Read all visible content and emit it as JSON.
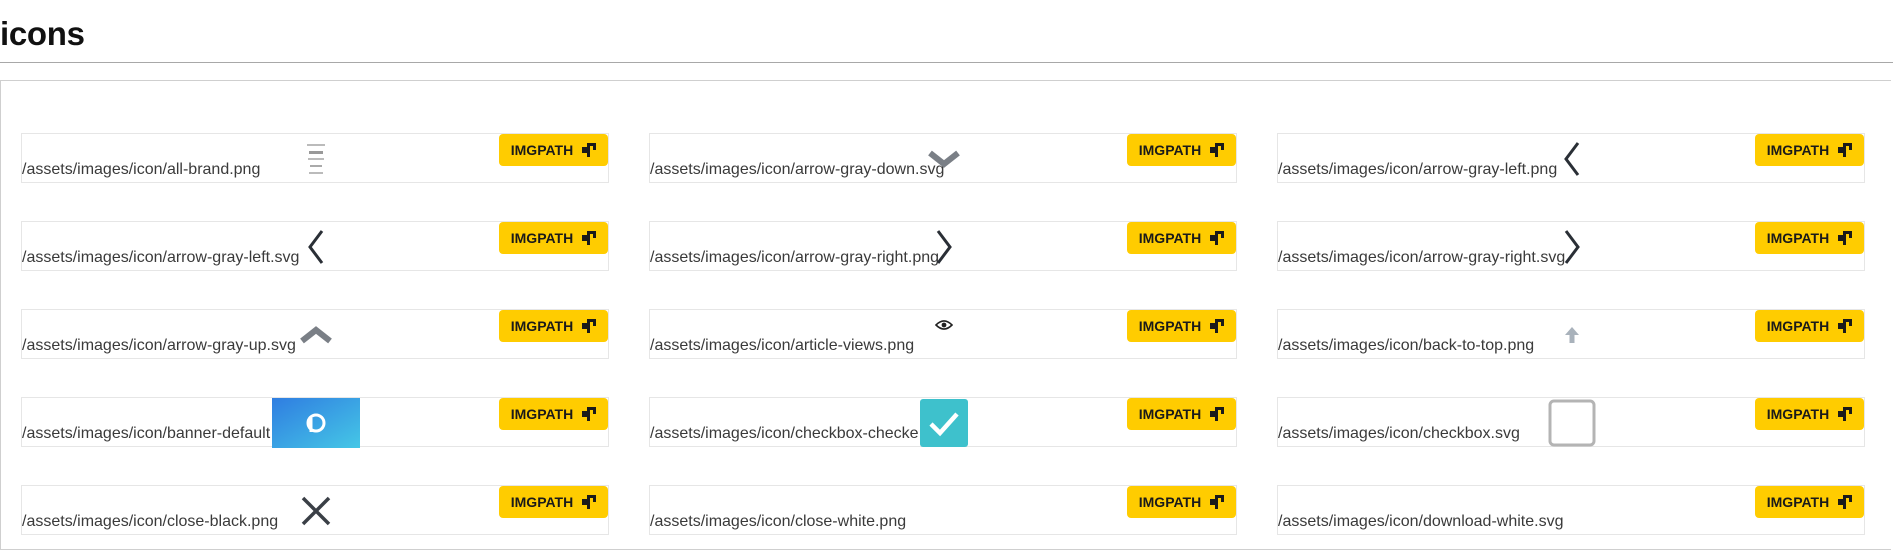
{
  "page": {
    "title": "icons"
  },
  "button_label": "IMGPATH",
  "colors": {
    "accent_button": "#ffcc00",
    "checkbox_checked": "#3ec1cc",
    "icon_gray": "#7a7f86",
    "icon_dark": "#2a2f36"
  },
  "icon_items": [
    {
      "path": "/assets/images/icon/all-brand.png",
      "preview_icon": "brand-logos-icon"
    },
    {
      "path": "/assets/images/icon/arrow-gray-down.svg",
      "preview_icon": "chevron-down-icon"
    },
    {
      "path": "/assets/images/icon/arrow-gray-left.png",
      "preview_icon": "chevron-left-icon"
    },
    {
      "path": "/assets/images/icon/arrow-gray-left.svg",
      "preview_icon": "chevron-left-icon"
    },
    {
      "path": "/assets/images/icon/arrow-gray-right.png",
      "preview_icon": "chevron-right-icon"
    },
    {
      "path": "/assets/images/icon/arrow-gray-right.svg",
      "preview_icon": "chevron-right-icon"
    },
    {
      "path": "/assets/images/icon/arrow-gray-up.svg",
      "preview_icon": "chevron-up-icon"
    },
    {
      "path": "/assets/images/icon/article-views.png",
      "preview_icon": "eye-icon"
    },
    {
      "path": "/assets/images/icon/back-to-top.png",
      "preview_icon": "arrow-up-icon"
    },
    {
      "path": "/assets/images/icon/banner-default",
      "preview_icon": "banner-image"
    },
    {
      "path": "/assets/images/icon/checkbox-checke",
      "preview_icon": "checkbox-checked-icon"
    },
    {
      "path": "/assets/images/icon/checkbox.svg",
      "preview_icon": "checkbox-icon"
    },
    {
      "path": "/assets/images/icon/close-black.png",
      "preview_icon": "close-icon"
    },
    {
      "path": "/assets/images/icon/close-white.png",
      "preview_icon": "close-white-icon"
    },
    {
      "path": "/assets/images/icon/download-white.svg",
      "preview_icon": "download-white-icon"
    }
  ]
}
